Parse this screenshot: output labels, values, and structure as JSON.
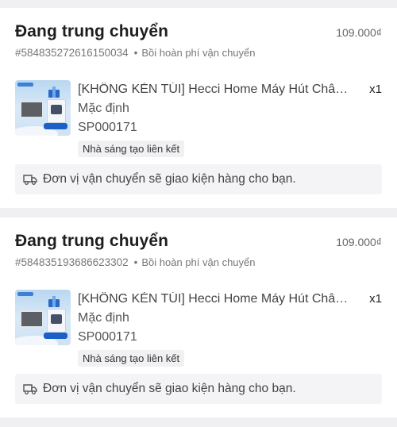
{
  "orders": [
    {
      "status": "Đang trung chuyển",
      "price": "109.000₫",
      "order_id": "#584835272616150034",
      "separator": "•",
      "refund_note": "Bồi hoàn phí vận chuyển",
      "item": {
        "name": "[KHÔNG KÉN TÚI]  Hecci Home Máy Hút Chân Không Thực Phẩm Gia Đình",
        "quantity": "x1",
        "variant": "Mặc định",
        "sku": "SP000171",
        "badge": "Nhà sáng tạo liên kết",
        "thumbnail_icon": "product-image"
      },
      "notice": "Đơn vị vận chuyển sẽ giao kiện hàng cho bạn.",
      "notice_icon": "delivery-truck-icon"
    },
    {
      "status": "Đang trung chuyển",
      "price": "109.000₫",
      "order_id": "#584835193686623302",
      "separator": "•",
      "refund_note": "Bồi hoàn phí vận chuyển",
      "item": {
        "name": "[KHÔNG KÉN TÚI]  Hecci Home Máy Hút Chân Không Thực Phẩm Gia Đình",
        "quantity": "x1",
        "variant": "Mặc định",
        "sku": "SP000171",
        "badge": "Nhà sáng tạo liên kết",
        "thumbnail_icon": "product-image"
      },
      "notice": "Đơn vị vận chuyển sẽ giao kiện hàng cho bạn.",
      "notice_icon": "delivery-truck-icon"
    }
  ],
  "colors": {
    "background": "#f0f0f2",
    "card": "#ffffff",
    "notice_bg": "#f4f4f6",
    "badge_bg": "#f1f1f3"
  }
}
